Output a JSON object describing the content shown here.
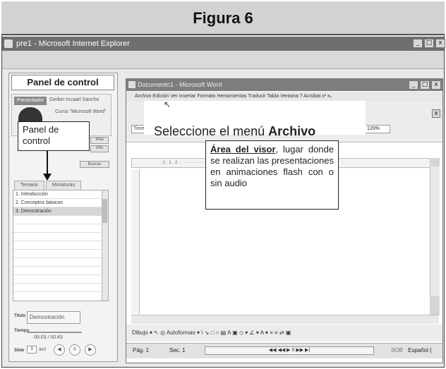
{
  "figure": {
    "title": "Figura 6"
  },
  "browser": {
    "title": "pre1 - Microsoft Internet Explorer",
    "buttons": [
      "_",
      "□",
      "x"
    ]
  },
  "left_panel": {
    "title": "Panel de control",
    "presenter_label": "Presentador",
    "presenter_name": "Gerber Incaarl Sanche",
    "course": "Curso \"Microsoft Word\"",
    "small_btn_1": "Imal",
    "small_btn_2": "Info",
    "search_label": "Buscar",
    "tabs": [
      "Temario",
      "Miniaturas"
    ],
    "toc": [
      "1. Introducción",
      "2. Conceptos básicos",
      "3. Demostración"
    ],
    "selected_index": 2,
    "title_label": "Título",
    "title_value": "Demostración",
    "time_label": "Tiempo",
    "time_value": "00:03 / 00:43",
    "slide_label": "Slide",
    "slide_num": "3",
    "slide_of": "de3",
    "nav_buttons": [
      "◀",
      "II",
      "▶"
    ]
  },
  "callout_panel": {
    "text": "Panel de control"
  },
  "word": {
    "title": "Documento1 - Microsoft Word",
    "buttons": [
      "_",
      "□",
      "x"
    ],
    "menu": "Archivo  Edición  Ver  Insertar  Formato  Herramientas  Traducir  Tabla  Ventana  ?  Acrobat  x²  x₂",
    "font": "Times New Roman",
    "zoom": "120%",
    "ruler": "· 1 · 1 · 2 · · · · · · · · · · · · · · · 8 · 1 · 9 · 1 · 10 · 1 ·",
    "drawing_toolbar": "Dibujo ▾   ↖  ◎   Autoformas ▾  \\  ↘  □  ○  ▤  A  ▣   ◇ ▾  ∠ ▾  A ▾  ≡  ≡  ⇄  ▣",
    "status": {
      "page": "Pág. 1",
      "section": "Sec. 1",
      "controls": "◀◀   ◀◀   ▶   II   ▶▶   ▶|",
      "sob": "SOB",
      "lang": "Español ("
    }
  },
  "overlay": {
    "text_prefix": "Seleccione el menú ",
    "text_bold": "Archivo",
    "cursor": "↖"
  },
  "callout_visor": {
    "title": "Área del visor",
    "body": ", lugar donde se realizan las presentaciones en animaciones flash con o sin audio"
  }
}
